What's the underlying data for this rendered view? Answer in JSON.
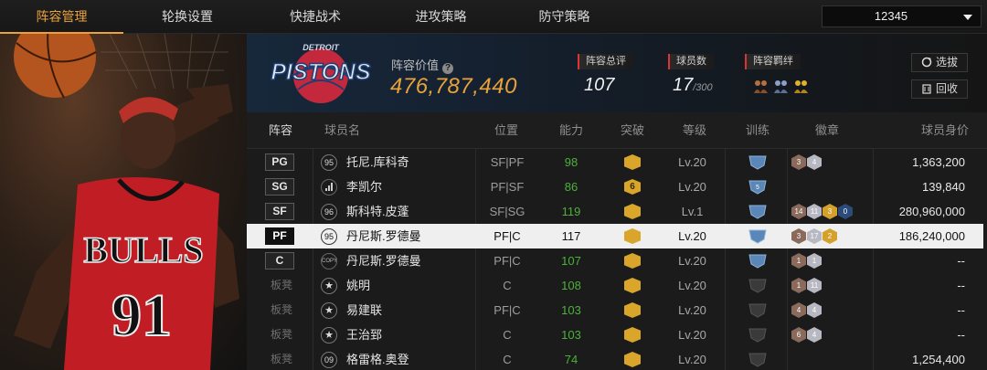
{
  "nav": {
    "tabs": [
      "阵容管理",
      "轮换设置",
      "快捷战术",
      "进攻策略",
      "防守策略"
    ],
    "active_index": 0,
    "dropdown_value": "12345"
  },
  "portrait": {
    "jersey_team": "BULLS",
    "jersey_number": "91"
  },
  "info": {
    "team_logo_text": "PISTONS",
    "team_logo_subtext": "DETROIT",
    "value_label": "阵容价值",
    "value": "476,787,440",
    "rating_label": "阵容总评",
    "rating": "107",
    "players_label": "球员数",
    "players": "17",
    "players_max": "/300",
    "bonds_label": "阵容羁绊",
    "select_button": "选拔",
    "recycle_button": "回收"
  },
  "table": {
    "headers": [
      "阵容",
      "球员名",
      "位置",
      "能力",
      "突破",
      "等级",
      "训练",
      "徽章",
      "球员身价"
    ],
    "rows": [
      {
        "slot": "PG",
        "bench": false,
        "badge": "95",
        "badge_type": "num",
        "name": "托尼.库科奇",
        "pos": "SF|PF",
        "ability": "98",
        "break": "",
        "level": "Lv.20",
        "train": "",
        "badges": [
          "3",
          "4"
        ],
        "worth": "1,363,200",
        "selected": false
      },
      {
        "slot": "SG",
        "bench": false,
        "badge": "",
        "badge_type": "bar",
        "name": "李凯尔",
        "pos": "PF|SF",
        "ability": "86",
        "break": "6",
        "level": "Lv.20",
        "train": "5",
        "badges": [],
        "worth": "139,840",
        "selected": false
      },
      {
        "slot": "SF",
        "bench": false,
        "badge": "96",
        "badge_type": "num",
        "name": "斯科特.皮蓬",
        "pos": "SF|SG",
        "ability": "119",
        "break": "",
        "level": "Lv.1",
        "train": "",
        "badges": [
          "14",
          "11",
          "3",
          "0"
        ],
        "worth": "280,960,000",
        "selected": false
      },
      {
        "slot": "PF",
        "bench": false,
        "badge": "95",
        "badge_type": "num",
        "name": "丹尼斯.罗德曼",
        "pos": "PF|C",
        "ability": "117",
        "break": "",
        "level": "Lv.20",
        "train": "",
        "badges": [
          "3",
          "17",
          "2"
        ],
        "worth": "186,240,000",
        "selected": true
      },
      {
        "slot": "C",
        "bench": false,
        "badge": "COPY",
        "badge_type": "copy",
        "name": "丹尼斯.罗德曼",
        "pos": "PF|C",
        "ability": "107",
        "break": "",
        "level": "Lv.20",
        "train": "",
        "badges": [
          "1",
          "1"
        ],
        "worth": "--",
        "selected": false
      },
      {
        "slot": "板凳",
        "bench": true,
        "badge": "★",
        "badge_type": "star",
        "name": "姚明",
        "pos": "C",
        "ability": "108",
        "break": "",
        "level": "Lv.20",
        "train": "",
        "badges": [
          "1",
          "11"
        ],
        "worth": "--",
        "selected": false
      },
      {
        "slot": "板凳",
        "bench": true,
        "badge": "★",
        "badge_type": "star",
        "name": "易建联",
        "pos": "PF|C",
        "ability": "103",
        "break": "",
        "level": "Lv.20",
        "train": "",
        "badges": [
          "4",
          "4"
        ],
        "worth": "--",
        "selected": false
      },
      {
        "slot": "板凳",
        "bench": true,
        "badge": "★",
        "badge_type": "star",
        "name": "王治郅",
        "pos": "C",
        "ability": "103",
        "break": "",
        "level": "Lv.20",
        "train": "",
        "badges": [
          "6",
          "4"
        ],
        "worth": "--",
        "selected": false
      },
      {
        "slot": "板凳",
        "bench": true,
        "badge": "09",
        "badge_type": "num",
        "name": "格雷格.奥登",
        "pos": "C",
        "ability": "74",
        "break": "",
        "level": "Lv.20",
        "train": "",
        "badges": [],
        "worth": "1,254,400",
        "selected": false
      }
    ]
  },
  "colors": {
    "accent": "#e9a23b",
    "ability_green": "#4cb13a",
    "bond_red": "#d33333",
    "selected_row": "#efefef"
  }
}
